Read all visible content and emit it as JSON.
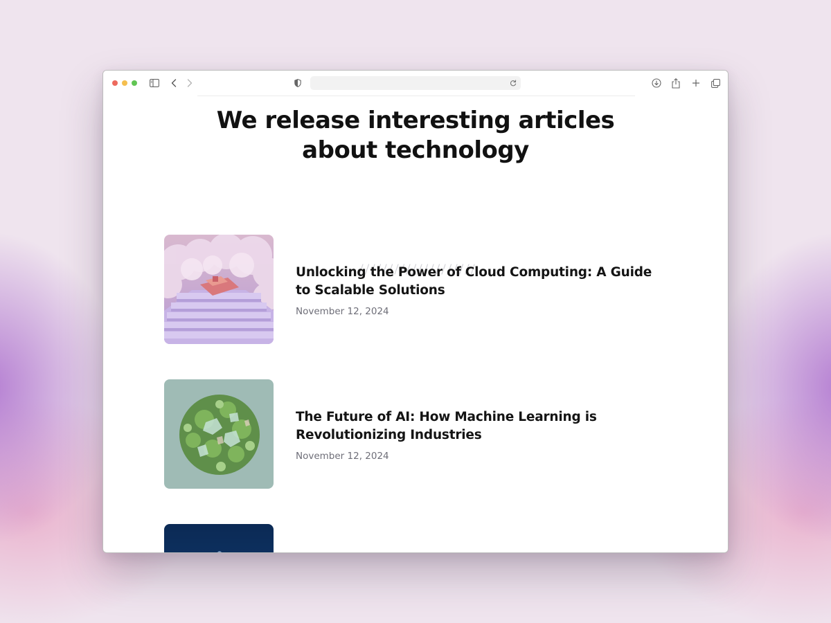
{
  "browser": {
    "toolbar_icons": {
      "sidebar": "sidebar-icon",
      "back": "chevron-left-icon",
      "forward": "chevron-right-icon",
      "privacy": "shield-icon",
      "reload": "reload-icon",
      "downloads": "download-icon",
      "share": "share-icon",
      "new_tab": "plus-icon",
      "tabs": "tabs-overview-icon"
    },
    "url": ""
  },
  "page": {
    "title": "We release interesting articles\nabout technology",
    "divider": "////////////////////"
  },
  "articles": [
    {
      "title": "Unlocking the Power of Cloud Computing: A Guide to Scalable Solutions",
      "date": "November 12, 2024",
      "thumbnail": "cloud-stairs-image"
    },
    {
      "title": "The Future of AI: How Machine Learning is Revolutionizing Industries",
      "date": "November 12, 2024",
      "thumbnail": "green-crystal-sphere-image"
    },
    {
      "title": "",
      "date": "",
      "thumbnail": "dark-blue-image"
    }
  ],
  "colors": {
    "background": "#efe4ee",
    "accent_purple": "#a05ac8",
    "title_text": "#111111",
    "date_text": "#6e6e78"
  }
}
